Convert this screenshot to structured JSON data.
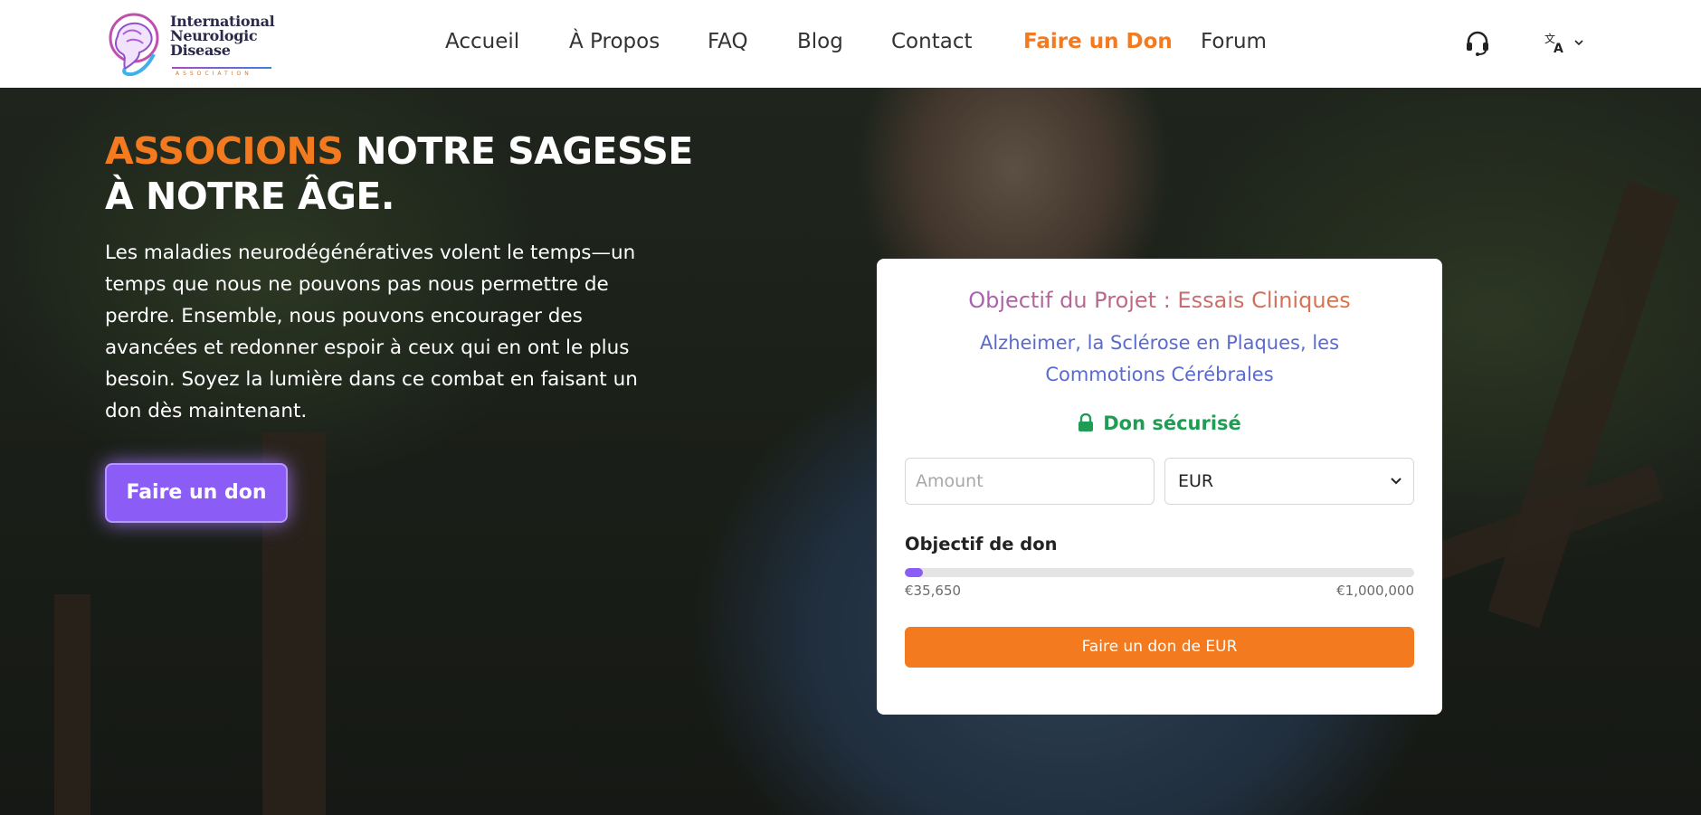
{
  "logo": {
    "line1": "International",
    "line2": "Neurologic",
    "line3": "Disease",
    "sub": "ASSOCIATION"
  },
  "nav": {
    "items": [
      "Accueil",
      "À Propos",
      "FAQ",
      "Blog",
      "Contact",
      "Faire un Don",
      "Forum"
    ],
    "active": "Faire un Don"
  },
  "header_icons": {
    "support": "headset-icon",
    "language": "translate-icon",
    "language_menu": "chevron-down-icon"
  },
  "hero": {
    "title_accent": "ASSOCIONS",
    "title_rest_line1": "NOTRE SAGESSE",
    "title_line2": "À NOTRE ÂGE.",
    "body": "Les maladies neurodégénératives volent le temps—un temps que nous ne pouvons pas nous permettre de perdre. Ensemble, nous pouvons encourager des avancées et redonner espoir à ceux qui en ont le plus besoin. Soyez la lumière dans ce combat en faisant un don dès maintenant.",
    "button": "Faire un don"
  },
  "donation": {
    "title": "Objectif du Projet : Essais Cliniques",
    "subtitle": "Alzheimer, la Sclérose en Plaques, les Commotions Cérébrales",
    "secure_label": "Don sécurisé",
    "secure_icon": "lock-icon",
    "amount_placeholder": "Amount",
    "currency": "EUR",
    "goal_label": "Objectif de don",
    "raised": "€35,650",
    "target": "€1,000,000",
    "progress_fraction": 0.03565,
    "submit": "Faire un don de EUR"
  },
  "colors": {
    "accent_orange": "#f47a1f",
    "accent_purple": "#8b5cf6",
    "secure_green": "#1f9d55",
    "subtitle_blue": "#5a6acf"
  }
}
